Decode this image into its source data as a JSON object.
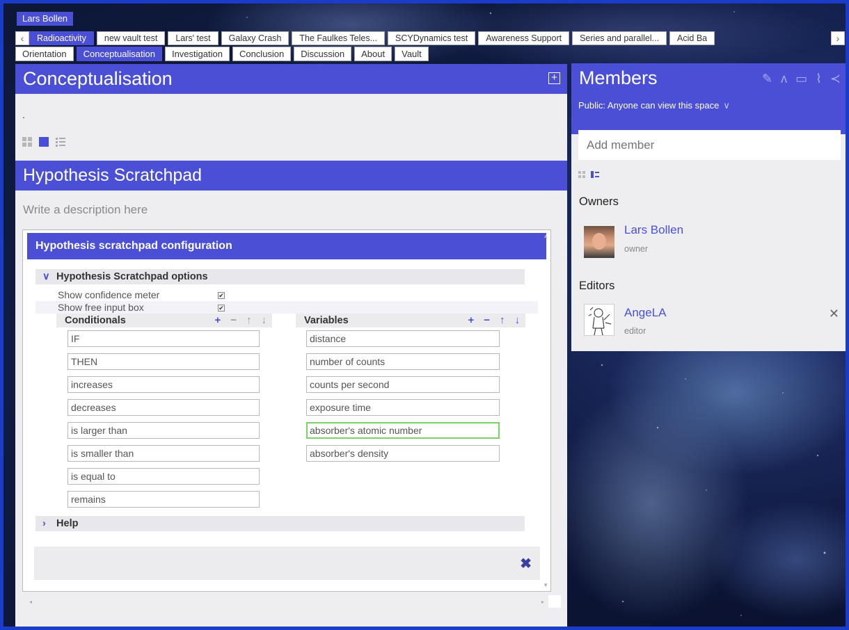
{
  "user": {
    "name": "Lars Bollen"
  },
  "space_tabs": [
    {
      "label": "Radioactivity",
      "active": true
    },
    {
      "label": "new vault test",
      "active": false
    },
    {
      "label": "Lars' test",
      "active": false
    },
    {
      "label": "Galaxy Crash",
      "active": false
    },
    {
      "label": "The Faulkes Teles...",
      "active": false
    },
    {
      "label": "SCYDynamics test",
      "active": false
    },
    {
      "label": "Awareness Support",
      "active": false
    },
    {
      "label": "Series and parallel...",
      "active": false
    },
    {
      "label": "Acid Ba",
      "active": false
    }
  ],
  "phase_tabs": [
    {
      "label": "Orientation",
      "active": false
    },
    {
      "label": "Conceptualisation",
      "active": true
    },
    {
      "label": "Investigation",
      "active": false
    },
    {
      "label": "Conclusion",
      "active": false
    },
    {
      "label": "Discussion",
      "active": false
    },
    {
      "label": "About",
      "active": false
    },
    {
      "label": "Vault",
      "active": false
    }
  ],
  "main": {
    "title": "Conceptualisation",
    "expand_glyph": "+",
    "dot": ".",
    "tool_title": "Hypothesis Scratchpad",
    "tool_description_placeholder": "Write a description here"
  },
  "config": {
    "title": "Hypothesis scratchpad configuration",
    "options_header": "Hypothesis Scratchpad options",
    "options": [
      {
        "label": "Show confidence meter",
        "checked": true
      },
      {
        "label": "Show free input box",
        "checked": true
      }
    ],
    "conditionals_header": "Conditionals",
    "variables_header": "Variables",
    "conditionals": [
      "IF",
      "THEN",
      "increases",
      "decreases",
      "is larger than",
      "is smaller than",
      "is equal to",
      "remains"
    ],
    "variables": [
      "distance",
      "number of counts",
      "counts per second",
      "exposure time",
      "absorber's atomic number",
      "absorber's density"
    ],
    "focused_variable_index": 4,
    "help_header": "Help",
    "close_glyph": "✖",
    "ctrl_add": "+",
    "ctrl_remove": "−",
    "ctrl_up": "↑",
    "ctrl_down": "↓"
  },
  "members": {
    "title": "Members",
    "visibility": "Public: Anyone can view this space",
    "add_placeholder": "Add member",
    "owners_label": "Owners",
    "editors_label": "Editors",
    "owners": [
      {
        "name": "Lars Bollen",
        "role": "owner"
      }
    ],
    "editors": [
      {
        "name": "AngeLA",
        "role": "editor"
      }
    ]
  },
  "icons": {
    "nav_left": "‹",
    "nav_right": "›",
    "pencil": "✎",
    "people": "ʌ",
    "chat": "▭",
    "activity": "⌇",
    "share": "≺",
    "chevron_down": "∨",
    "remove": "✕"
  },
  "colors": {
    "accent": "#4b4fd6",
    "focus": "#7bd16a",
    "frame": "#1a3cc8"
  }
}
